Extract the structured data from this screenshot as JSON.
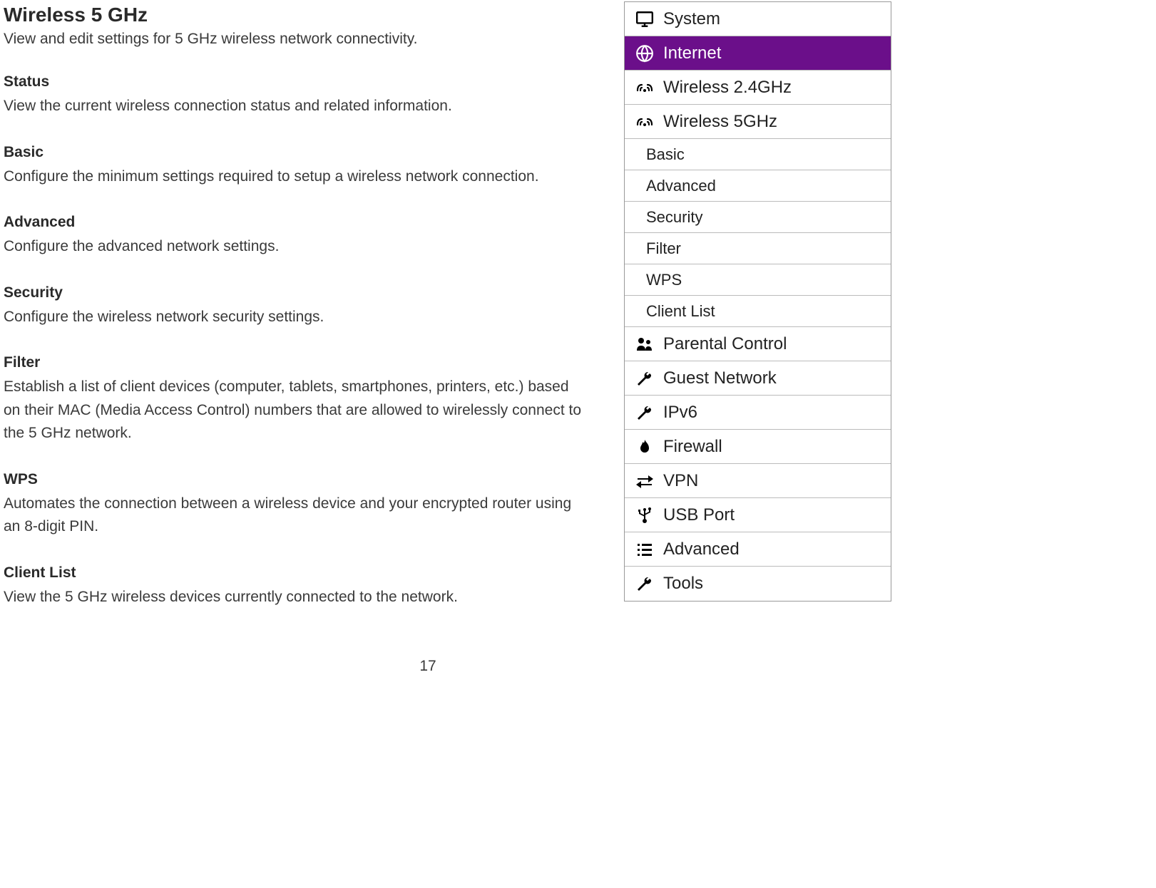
{
  "main": {
    "title": "Wireless 5 GHz",
    "subtitle": "View and edit settings for 5 GHz wireless network connectivity.",
    "sections": [
      {
        "title": "Status",
        "desc": "View the current wireless connection status and related information."
      },
      {
        "title": "Basic",
        "desc": "Configure the minimum settings required to setup a wireless network connection."
      },
      {
        "title": "Advanced",
        "desc": "Configure the advanced network settings."
      },
      {
        "title": "Security",
        "desc": "Configure the wireless network security settings."
      },
      {
        "title": "Filter",
        "desc": "Establish a list of client devices (computer, tablets, smartphones, printers, etc.) based on their MAC (Media Access Control) numbers that are allowed to wirelessly connect to the 5 GHz network."
      },
      {
        "title": "WPS",
        "desc": "Automates the connection between a wireless device and your encrypted router using an 8-digit PIN."
      },
      {
        "title": "Client List",
        "desc": "View the 5 GHz wireless devices currently connected to the network."
      }
    ],
    "page_number": "17"
  },
  "sidebar": {
    "items": [
      {
        "label": "System",
        "icon": "monitor"
      },
      {
        "label": "Internet",
        "icon": "globe",
        "selected": true
      },
      {
        "label": "Wireless 2.4GHz",
        "icon": "wifi"
      },
      {
        "label": "Wireless 5GHz",
        "icon": "wifi"
      }
    ],
    "sub_items": [
      {
        "label": "Basic"
      },
      {
        "label": "Advanced"
      },
      {
        "label": "Security"
      },
      {
        "label": "Filter"
      },
      {
        "label": "WPS"
      },
      {
        "label": "Client List"
      }
    ],
    "items_after": [
      {
        "label": "Parental Control",
        "icon": "people"
      },
      {
        "label": "Guest Network",
        "icon": "wrench"
      },
      {
        "label": "IPv6",
        "icon": "wrench"
      },
      {
        "label": "Firewall",
        "icon": "fire"
      },
      {
        "label": "VPN",
        "icon": "swap"
      },
      {
        "label": "USB Port",
        "icon": "usb"
      },
      {
        "label": "Advanced",
        "icon": "list"
      },
      {
        "label": "Tools",
        "icon": "wrench"
      }
    ]
  },
  "colors": {
    "accent": "#6b0f8a"
  }
}
